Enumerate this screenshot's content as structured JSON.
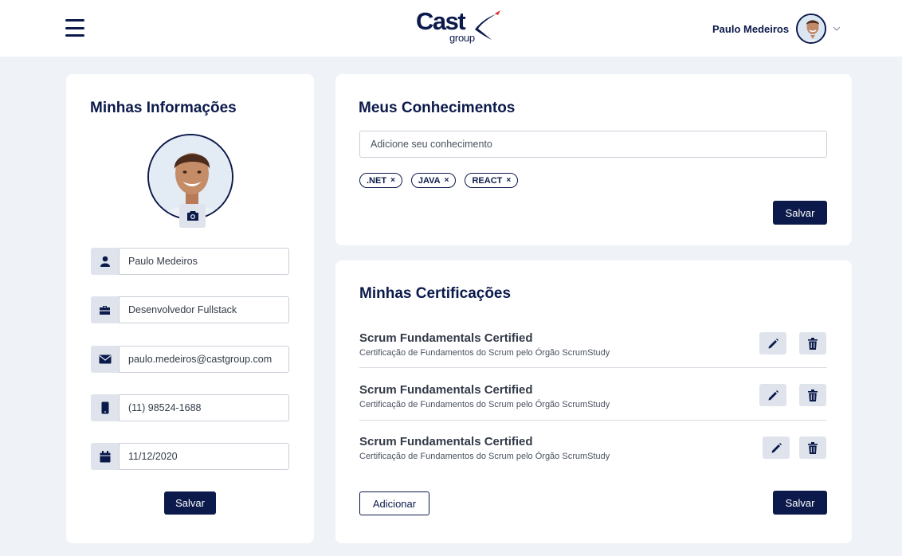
{
  "header": {
    "logo_main": "Cast",
    "logo_sub": "group",
    "user_name": "Paulo Medeiros"
  },
  "profile_card": {
    "title": "Minhas Informações",
    "fields": {
      "name": "Paulo Medeiros",
      "role": "Desenvolvedor Fullstack",
      "email": "paulo.medeiros@castgroup.com",
      "phone": "(11) 98524-1688",
      "date": "11/12/2020"
    },
    "save_label": "Salvar"
  },
  "skills_card": {
    "title": "Meus Conhecimentos",
    "input_placeholder": "Adicione seu conhecimento",
    "tags": [
      ".NET",
      "JAVA",
      "REACT"
    ],
    "tag_remove": "×",
    "save_label": "Salvar"
  },
  "certs_card": {
    "title": "Minhas Certificações",
    "items": [
      {
        "title": "Scrum Fundamentals Certified",
        "description": "Certificação de Fundamentos do Scrum pelo Órgão ScrumStudy"
      },
      {
        "title": "Scrum Fundamentals Certified",
        "description": "Certificação de Fundamentos do Scrum pelo Órgão ScrumStudy"
      },
      {
        "title": "Scrum Fundamentals Certified",
        "description": "Certificação de Fundamentos do Scrum pelo Órgão ScrumStudy"
      }
    ],
    "add_label": "Adicionar",
    "save_label": "Salvar"
  },
  "icons": {
    "menu": "hamburger-menu-icon",
    "chevron": "chevron-down-icon",
    "camera": "camera-icon",
    "user": "user-icon",
    "briefcase": "briefcase-icon",
    "email": "envelope-icon",
    "phone": "mobile-phone-icon",
    "calendar": "calendar-icon",
    "edit": "pencil-icon",
    "delete": "trash-icon"
  },
  "colors": {
    "primary": "#0c1a4b",
    "background": "#eff2f6",
    "icon_bg": "#dfe4ec",
    "accent_red": "#e0302a"
  }
}
